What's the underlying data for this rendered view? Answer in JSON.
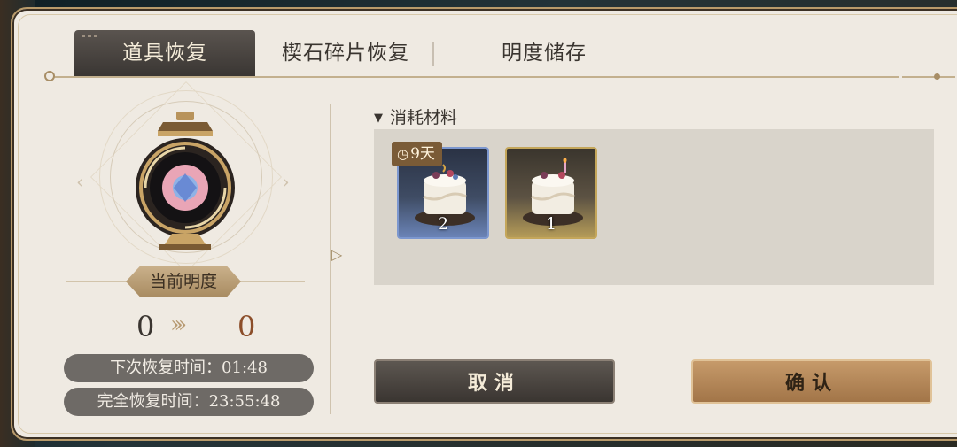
{
  "tabs": [
    {
      "label": "道具恢复",
      "active": true
    },
    {
      "label": "楔石碎片恢复",
      "active": false
    },
    {
      "label": "明度储存",
      "active": false
    }
  ],
  "left": {
    "brightness_label": "当前明度",
    "current_value": "0",
    "next_value": "0",
    "next_recovery": "下次恢复时间：01:48",
    "full_recovery": "完全恢复时间：23:55:48"
  },
  "materials": {
    "title": "消耗材料",
    "items": [
      {
        "name": "cake-item",
        "count": "2",
        "timer": "9天",
        "frame_color": "#7c97cf"
      },
      {
        "name": "cake-item",
        "count": "1",
        "timer": "",
        "frame_color": "#c4a65a"
      }
    ]
  },
  "buttons": {
    "cancel": "取消",
    "confirm": "确认"
  },
  "colors": {
    "panel": "#efeae2",
    "accent": "#a98c62",
    "confirm": "#b48558",
    "cancel": "#4a4540"
  }
}
